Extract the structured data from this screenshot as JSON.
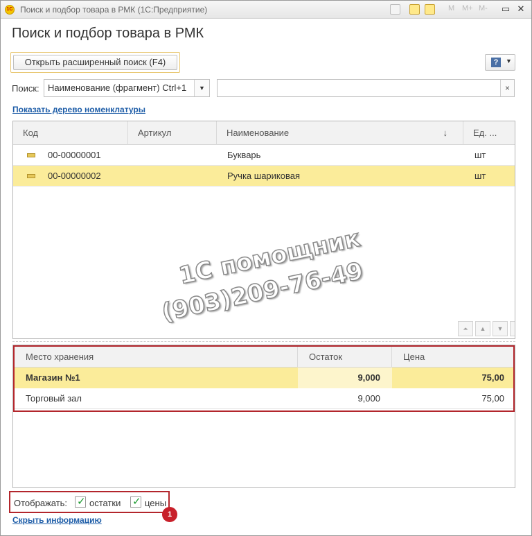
{
  "window": {
    "title": "Поиск и подбор товара в РМК  (1С:Предприятие)",
    "logo_text": "1С",
    "toolbar_glyphs": [
      "M",
      "M+",
      "M-"
    ]
  },
  "page": {
    "title": "Поиск и подбор товара в РМК"
  },
  "buttons": {
    "advanced_search": "Открыть расширенный поиск (F4)",
    "help_glyph": "?"
  },
  "search": {
    "label": "Поиск:",
    "field_option": "Наименование (фрагмент) Ctrl+1",
    "value": "",
    "clear_glyph": "×"
  },
  "links": {
    "show_tree": "Показать дерево номенклатуры",
    "hide_info": "Скрыть информацию"
  },
  "products": {
    "columns": [
      "Код",
      "Артикул",
      "Наименование",
      "Ед. ..."
    ],
    "rows": [
      {
        "code": "00-00000001",
        "article": "",
        "name": "Букварь",
        "unit": "шт"
      },
      {
        "code": "00-00000002",
        "article": "",
        "name": "Ручка шариковая",
        "unit": "шт"
      }
    ],
    "selected_row": 1
  },
  "watermark": {
    "line1": "1С помощник",
    "line2": "(903)209-76-49"
  },
  "stock": {
    "columns": [
      "Место хранения",
      "Остаток",
      "Цена"
    ],
    "rows": [
      {
        "place": "Магазин №1",
        "qty": "9,000",
        "price": "75,00"
      },
      {
        "place": "Торговый зал",
        "qty": "9,000",
        "price": "75,00"
      }
    ]
  },
  "display": {
    "label": "Отображать:",
    "options": [
      {
        "label": "остатки",
        "checked": true
      },
      {
        "label": "цены",
        "checked": true
      }
    ],
    "badge": "1"
  },
  "colors": {
    "selection": "#fbec9a",
    "highlight_red": "#b3262c",
    "link": "#1f5ea8",
    "check_green": "#1a9a2e"
  }
}
